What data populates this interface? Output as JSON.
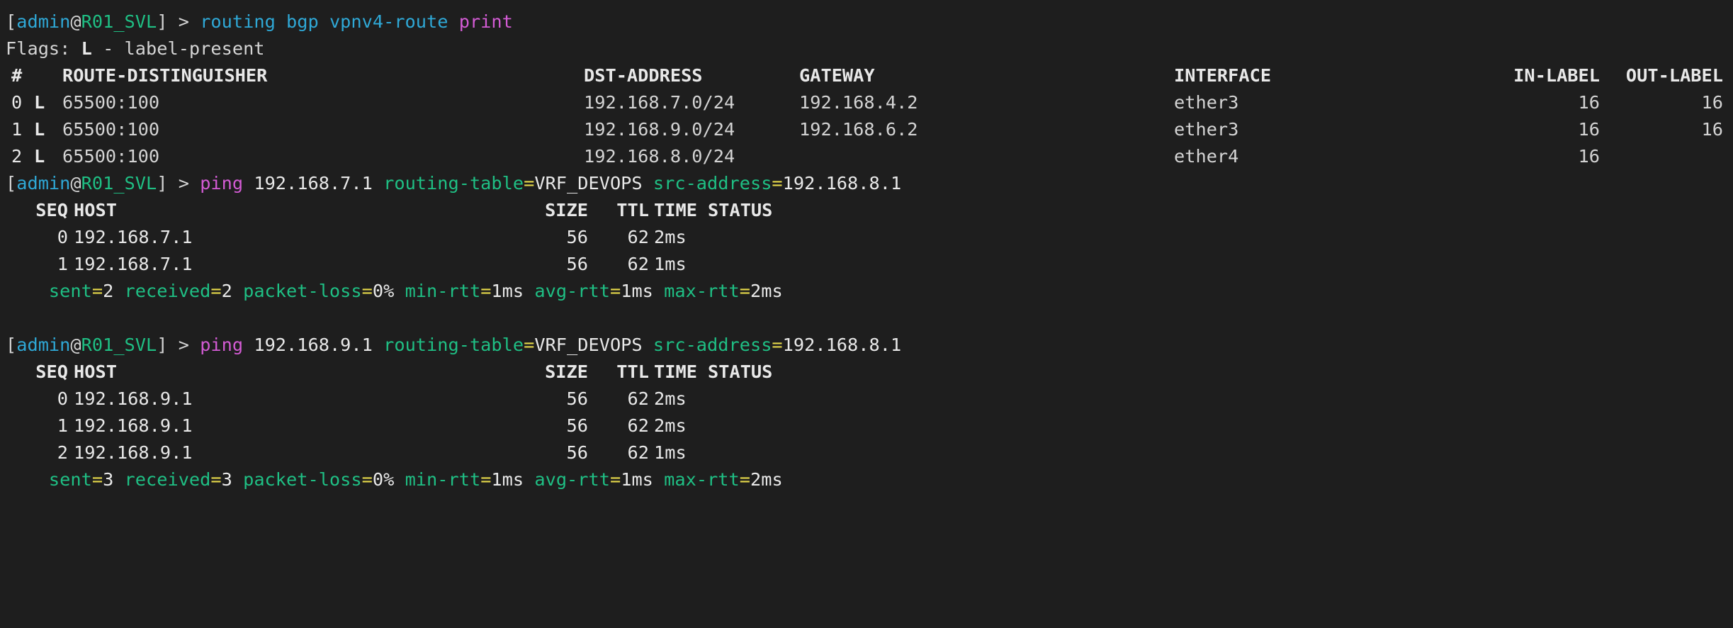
{
  "prompt": {
    "open": "[",
    "user": "admin",
    "at": "@",
    "host": "R01_SVL",
    "close": "]",
    "arrow": " > "
  },
  "command1": {
    "words": "routing bgp vpnv4-route",
    "verb": "print"
  },
  "flags_line": {
    "prefix": "Flags: ",
    "flag": "L",
    "text": " - label-present"
  },
  "route_table": {
    "headers": {
      "num": "#",
      "rd": "ROUTE-DISTINGUISHER",
      "dst": "DST-ADDRESS",
      "gateway": "GATEWAY",
      "interface": "INTERFACE",
      "in_label": "IN-LABEL",
      "out_label": "OUT-LABEL"
    },
    "rows": [
      {
        "num": "0",
        "flag": "L",
        "rd": "65500:100",
        "dst": "192.168.7.0/24",
        "gateway": "192.168.4.2",
        "interface": "ether3",
        "in_label": "16",
        "out_label": "16"
      },
      {
        "num": "1",
        "flag": "L",
        "rd": "65500:100",
        "dst": "192.168.9.0/24",
        "gateway": "192.168.6.2",
        "interface": "ether3",
        "in_label": "16",
        "out_label": "16"
      },
      {
        "num": "2",
        "flag": "L",
        "rd": "65500:100",
        "dst": "192.168.8.0/24",
        "gateway": "",
        "interface": "ether4",
        "in_label": "16",
        "out_label": ""
      }
    ]
  },
  "pings": [
    {
      "verb": "ping",
      "target": "192.168.7.1",
      "rt_key": "routing-table",
      "rt_eq": "=",
      "rt_val": "VRF_DEVOPS",
      "src_key": "src-address",
      "src_eq": "=",
      "src_val": "192.168.8.1",
      "headers": {
        "seq": "SEQ",
        "host": "HOST",
        "size": "SIZE",
        "ttl": "TTL",
        "time": "TIME",
        "status": "STATUS"
      },
      "rows": [
        {
          "seq": "0",
          "host": "192.168.7.1",
          "size": "56",
          "ttl": "62",
          "time": "2ms"
        },
        {
          "seq": "1",
          "host": "192.168.7.1",
          "size": "56",
          "ttl": "62",
          "time": "1ms"
        }
      ],
      "summary": {
        "sent_k": "sent",
        "sent_v": "2",
        "recv_k": "received",
        "recv_v": "2",
        "loss_k": "packet-loss",
        "loss_v": "0%",
        "min_k": "min-rtt",
        "min_v": "1ms",
        "avg_k": "avg-rtt",
        "avg_v": "1ms",
        "max_k": "max-rtt",
        "max_v": "2ms"
      }
    },
    {
      "verb": "ping",
      "target": "192.168.9.1",
      "rt_key": "routing-table",
      "rt_eq": "=",
      "rt_val": "VRF_DEVOPS",
      "src_key": "src-address",
      "src_eq": "=",
      "src_val": "192.168.8.1",
      "headers": {
        "seq": "SEQ",
        "host": "HOST",
        "size": "SIZE",
        "ttl": "TTL",
        "time": "TIME",
        "status": "STATUS"
      },
      "rows": [
        {
          "seq": "0",
          "host": "192.168.9.1",
          "size": "56",
          "ttl": "62",
          "time": "2ms"
        },
        {
          "seq": "1",
          "host": "192.168.9.1",
          "size": "56",
          "ttl": "62",
          "time": "2ms"
        },
        {
          "seq": "2",
          "host": "192.168.9.1",
          "size": "56",
          "ttl": "62",
          "time": "1ms"
        }
      ],
      "summary": {
        "sent_k": "sent",
        "sent_v": "3",
        "recv_k": "received",
        "recv_v": "3",
        "loss_k": "packet-loss",
        "loss_v": "0%",
        "min_k": "min-rtt",
        "min_v": "1ms",
        "avg_k": "avg-rtt",
        "avg_v": "1ms",
        "max_k": "max-rtt",
        "max_v": "2ms"
      }
    }
  ],
  "colors": {
    "background": "#1e1e1e",
    "prompt_user": "#2fa8d6",
    "prompt_host": "#1fbf84",
    "command_verb": "#d35bd4",
    "param_key": "#1fbf84",
    "equals": "#e5d84a"
  }
}
